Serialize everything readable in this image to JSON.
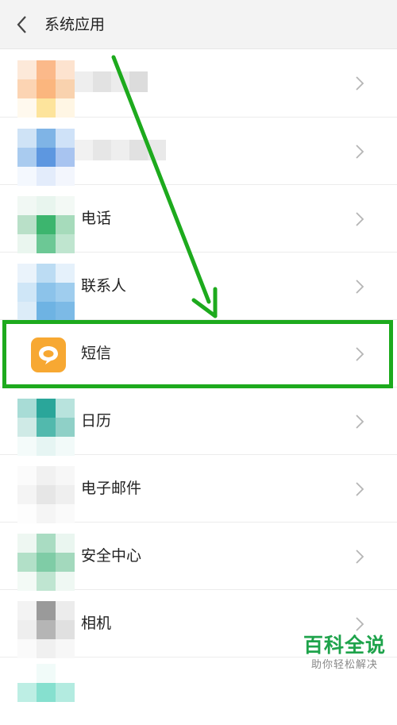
{
  "header": {
    "title": "系统应用",
    "back_icon": "chevron-left-icon"
  },
  "apps": [
    {
      "label": "",
      "icon": "blurred-app-icon"
    },
    {
      "label": "",
      "icon": "blurred-app-icon"
    },
    {
      "label": "电话",
      "icon": "phone-app-icon"
    },
    {
      "label": "联系人",
      "icon": "contacts-app-icon"
    },
    {
      "label": "短信",
      "icon": "messages-app-icon",
      "icon_color": "#f7a832",
      "highlighted": true
    },
    {
      "label": "日历",
      "icon": "calendar-app-icon"
    },
    {
      "label": "电子邮件",
      "icon": "email-app-icon"
    },
    {
      "label": "安全中心",
      "icon": "security-app-icon"
    },
    {
      "label": "相机",
      "icon": "camera-app-icon"
    }
  ],
  "annotation": {
    "color": "#1daa1d",
    "shape": "arrow-and-box"
  },
  "watermark": {
    "brand": "百科全说",
    "slogan": "助你轻松解决",
    "color": "#1ea34b"
  }
}
